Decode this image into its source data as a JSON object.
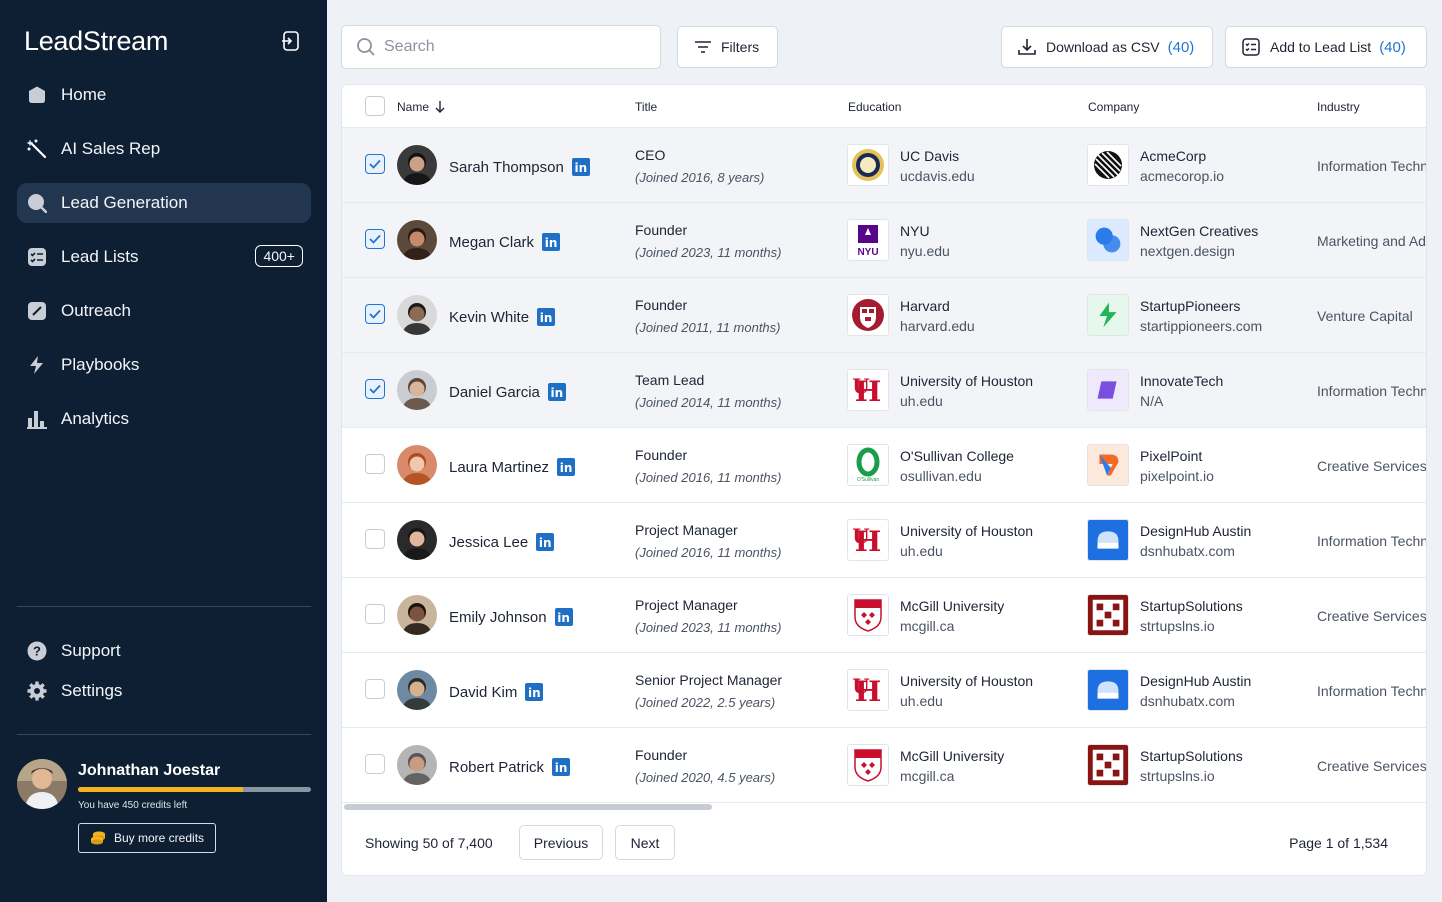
{
  "app": {
    "brand": "LeadStream"
  },
  "sidebar": {
    "items": [
      {
        "label": "Home",
        "icon": "home-icon"
      },
      {
        "label": "AI Sales Rep",
        "icon": "magic-wand-icon"
      },
      {
        "label": "Lead Generation",
        "icon": "search-icon",
        "active": true
      },
      {
        "label": "Lead Lists",
        "icon": "checklist-icon",
        "badge": "400+"
      },
      {
        "label": "Outreach",
        "icon": "edit-icon"
      },
      {
        "label": "Playbooks",
        "icon": "lightning-icon"
      },
      {
        "label": "Analytics",
        "icon": "bar-chart-icon"
      }
    ],
    "support": "Support",
    "settings": "Settings"
  },
  "user": {
    "name": "Johnathan Joestar",
    "credits_text": "You have 450 credits left",
    "credits_fraction": 0.71,
    "buy_label": "Buy more credits"
  },
  "toolbar": {
    "search_placeholder": "Search",
    "filters_label": "Filters",
    "download_label": "Download as CSV",
    "download_count": "(40)",
    "add_label": "Add to Lead List",
    "add_count": "(40)"
  },
  "table": {
    "headers": {
      "name": "Name",
      "title": "Title",
      "education": "Education",
      "company": "Company",
      "industry": "Industry"
    },
    "rows": [
      {
        "checked": true,
        "name": "Sarah Thompson",
        "title": "CEO",
        "joined": "(Joined 2016, 8 years)",
        "edu": "UC Davis",
        "edu_domain": "ucdavis.edu",
        "company": "AcmeCorp",
        "company_domain": "acmecorop.io",
        "industry": "Information Technology"
      },
      {
        "checked": true,
        "name": "Megan Clark",
        "title": "Founder",
        "joined": "(Joined 2023, 11 months)",
        "edu": "NYU",
        "edu_domain": "nyu.edu",
        "company": "NextGen Creatives",
        "company_domain": "nextgen.design",
        "industry": "Marketing and Advertising"
      },
      {
        "checked": true,
        "name": "Kevin White",
        "title": "Founder",
        "joined": "(Joined 2011, 11 months)",
        "edu": "Harvard",
        "edu_domain": "harvard.edu",
        "company": "StartupPioneers",
        "company_domain": "startippioneers.com",
        "industry": "Venture Capital"
      },
      {
        "checked": true,
        "name": "Daniel Garcia",
        "title": "Team Lead",
        "joined": "(Joined 2014, 11 months)",
        "edu": "University of Houston",
        "edu_domain": "uh.edu",
        "company": "InnovateTech",
        "company_domain": "N/A",
        "industry": "Information Technology"
      },
      {
        "checked": false,
        "name": "Laura Martinez",
        "title": "Founder",
        "joined": "(Joined 2016, 11 months)",
        "edu": "O'Sullivan College",
        "edu_domain": "osullivan.edu",
        "company": "PixelPoint",
        "company_domain": "pixelpoint.io",
        "industry": "Creative Services"
      },
      {
        "checked": false,
        "name": "Jessica Lee",
        "title": "Project Manager",
        "joined": "(Joined 2016, 11 months)",
        "edu": "University of Houston",
        "edu_domain": "uh.edu",
        "company": "DesignHub Austin",
        "company_domain": "dsnhubatx.com",
        "industry": "Information Technology"
      },
      {
        "checked": false,
        "name": "Emily Johnson",
        "title": "Project Manager",
        "joined": "(Joined 2023, 11 months)",
        "edu": "McGill University",
        "edu_domain": "mcgill.ca",
        "company": "StartupSolutions",
        "company_domain": "strtupslns.io",
        "industry": "Creative Services"
      },
      {
        "checked": false,
        "name": "David Kim",
        "title": "Senior Project Manager",
        "joined": "(Joined 2022, 2.5 years)",
        "edu": "University of Houston",
        "edu_domain": "uh.edu",
        "company": "DesignHub Austin",
        "company_domain": "dsnhubatx.com",
        "industry": "Information Technology"
      },
      {
        "checked": false,
        "name": "Robert Patrick",
        "title": "Founder",
        "joined": "(Joined 2020, 4.5 years)",
        "edu": "McGill University",
        "edu_domain": "mcgill.ca",
        "company": "StartupSolutions",
        "company_domain": "strtupslns.io",
        "industry": "Creative Services"
      }
    ]
  },
  "pagination": {
    "showing": "Showing 50 of 7,400",
    "previous": "Previous",
    "next": "Next",
    "page": "Page 1 of 1,534"
  },
  "colors": {
    "sidebar_bg": "#0f1f33",
    "accent": "#1f76d0",
    "credit": "#f5b321"
  }
}
